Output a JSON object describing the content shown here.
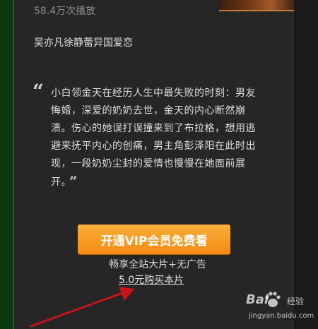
{
  "header": {
    "views": "58.4万次播放"
  },
  "details": {
    "cast": "吴亦凡徐静蕾异国爱恋",
    "quote_open": "“",
    "synopsis": "小白领金天在经历人生中最失败的时刻：男友悔婚，深爱的奶奶去世，金天的内心断然崩溃。伤心的她误打误撞来到了布拉格，想用逃避来抚平内心的创痛，男主角彭泽阳在此时出现，一段奶奶尘封的爱情也慢慢在她面前展开。",
    "quote_close": "”"
  },
  "cta": {
    "vip_button": "开通VIP会员免费看",
    "benefit": "畅享全站大片+无广告",
    "buy_link": "5.0元购买本片"
  },
  "watermark": {
    "logo": "Bai",
    "logo_suffix": "经验",
    "url": "jingyan.baidu.com"
  },
  "colors": {
    "button": "#f7971e",
    "arrow": "#c8141a",
    "panel": "#262626"
  }
}
